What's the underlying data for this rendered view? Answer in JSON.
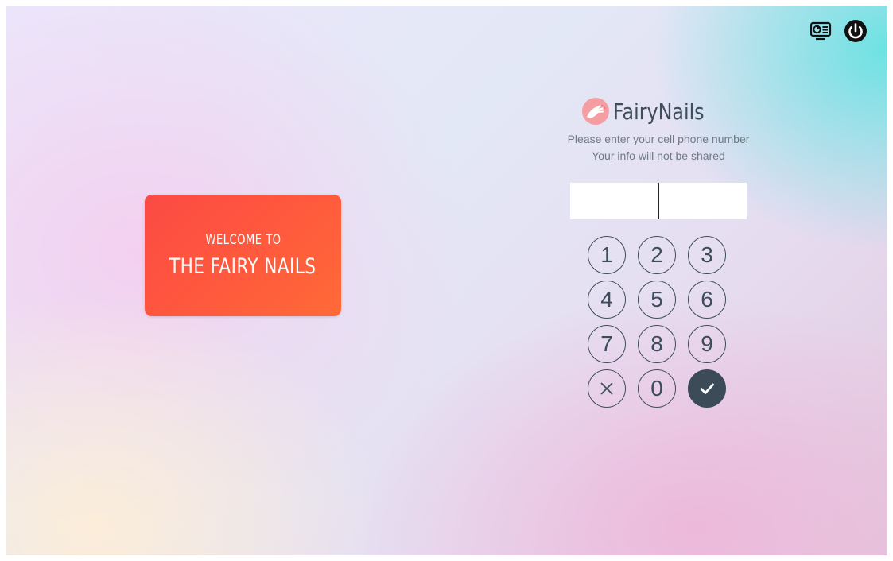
{
  "brand": {
    "name": "FairyNails",
    "logo_icon": "hand-nail-logo-icon"
  },
  "welcome": {
    "line1": "WELCOME TO",
    "line2": "THE FAIRY NAILS"
  },
  "instructions": {
    "line1": "Please enter your cell phone number",
    "line2": "Your info will not be shared"
  },
  "phone": {
    "value": "",
    "placeholder": ""
  },
  "keypad": {
    "keys": [
      "1",
      "2",
      "3",
      "4",
      "5",
      "6",
      "7",
      "8",
      "9"
    ],
    "clear_icon": "clear-icon",
    "zero": "0",
    "confirm_icon": "checkmark-icon"
  },
  "toolbar": {
    "left_icon": "display-settings-icon",
    "right_icon": "power-icon"
  },
  "colors": {
    "card_gradient_start": "#fb4a44",
    "card_gradient_end": "#ff6a37",
    "text_dark": "#3f4e5a",
    "text_muted": "#6f7a82",
    "key_border": "#3d4e5a",
    "confirm_bg": "#3b4c58"
  }
}
